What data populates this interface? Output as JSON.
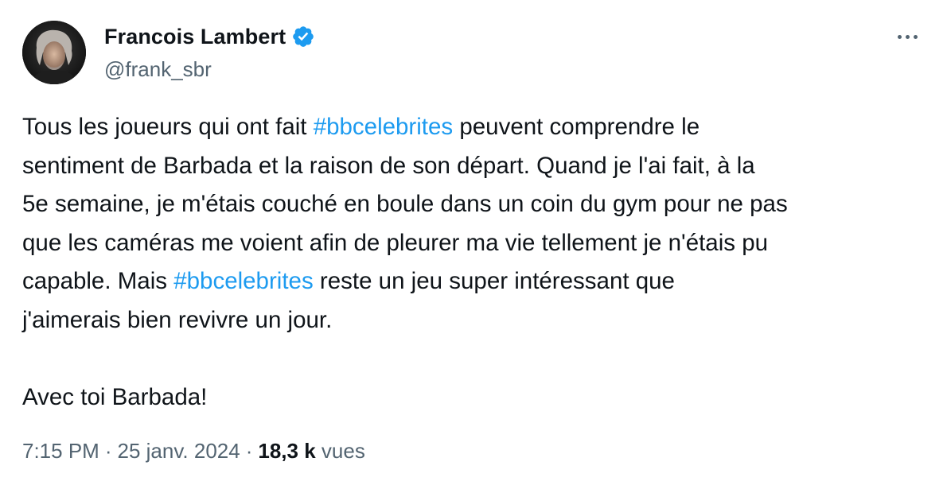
{
  "author": {
    "display_name": "Francois Lambert",
    "handle": "@frank_sbr",
    "verified_icon": "verified-badge-icon"
  },
  "more_icon": "more-horizontal-icon",
  "tweet": {
    "lines": [
      [
        {
          "text": "Tous les joueurs qui ont fait "
        },
        {
          "text": "#bbcelebrites",
          "hashtag": true
        },
        {
          "text": " peuvent comprendre le"
        }
      ],
      [
        {
          "text": "sentiment de Barbada et la raison de son départ. Quand je l'ai fait, à la"
        }
      ],
      [
        {
          "text": "5e semaine, je m'étais couché en boule dans un coin du gym pour ne pas"
        }
      ],
      [
        {
          "text": "que les caméras me voient afin de pleurer ma vie tellement je n'étais pu"
        }
      ],
      [
        {
          "text": "capable. Mais "
        },
        {
          "text": "#bbcelebrites",
          "hashtag": true
        },
        {
          "text": " reste un jeu super intéressant que"
        }
      ],
      [
        {
          "text": "j'aimerais bien revivre un jour."
        }
      ],
      [],
      [
        {
          "text": "Avec toi Barbada!"
        }
      ]
    ]
  },
  "meta": {
    "time": "7:15 PM",
    "separator": "·",
    "date": "25 janv. 2024",
    "views_count": "18,3 k",
    "views_label": "vues"
  },
  "colors": {
    "text": "#0f1419",
    "secondary": "#536471",
    "link": "#1d9bf0",
    "verified": "#1d9bf0"
  }
}
